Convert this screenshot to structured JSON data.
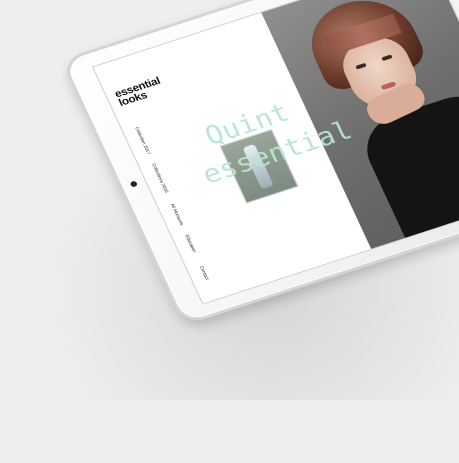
{
  "brand": {
    "line1": "essential",
    "line2": "looks"
  },
  "menu": [
    {
      "label": "Collection 2017"
    },
    {
      "label": "Collections 2016"
    },
    {
      "label": "All Moments"
    },
    {
      "label": "Education"
    },
    {
      "label": "Contact"
    }
  ],
  "hero_text": {
    "line1": "Quint",
    "line2": "essential"
  },
  "icons": {
    "menu": "menu-dots-icon",
    "search": "search-icon"
  },
  "colors": {
    "accent_text": "#b7e6cf",
    "device_frame": "#d4d4d4"
  }
}
